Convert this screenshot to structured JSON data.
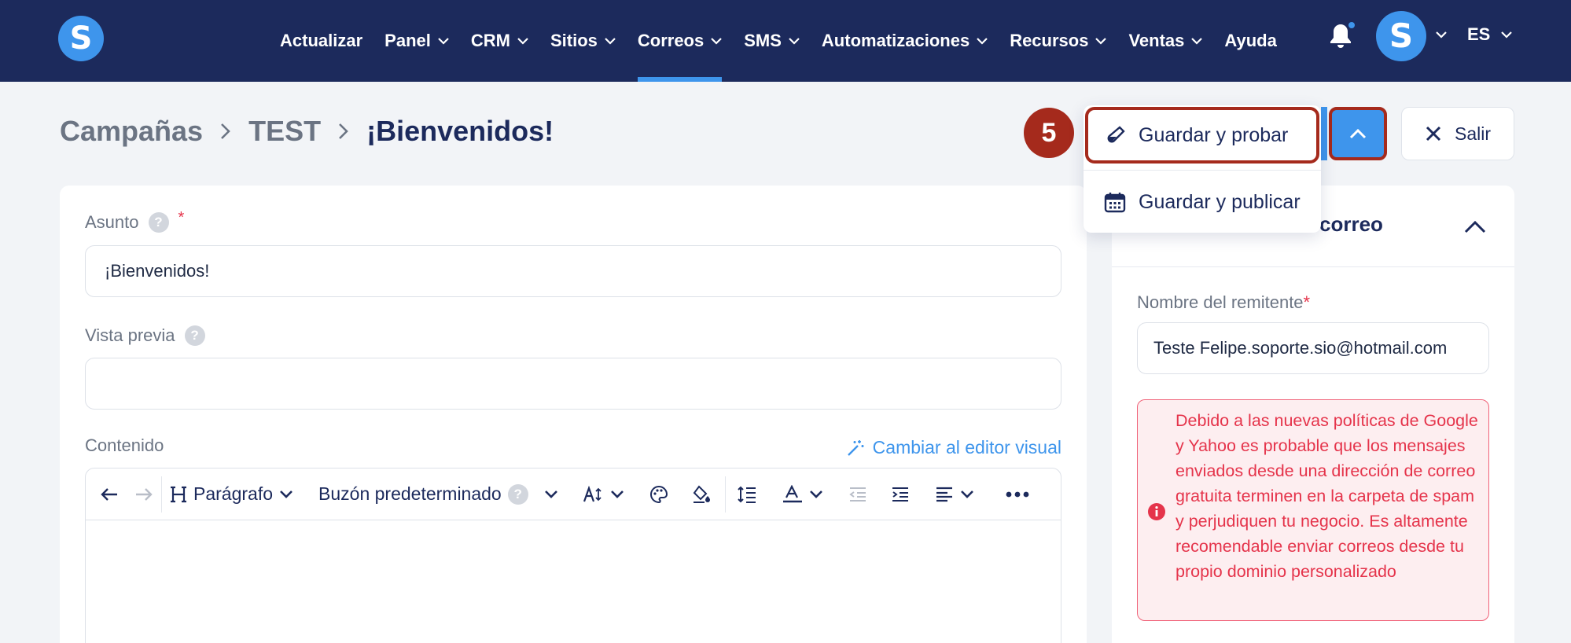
{
  "nav": {
    "logo_letter": "S",
    "items": [
      {
        "label": "Actualizar",
        "has_chevron": false,
        "active": false
      },
      {
        "label": "Panel",
        "has_chevron": true,
        "active": false
      },
      {
        "label": "CRM",
        "has_chevron": true,
        "active": false
      },
      {
        "label": "Sitios",
        "has_chevron": true,
        "active": false
      },
      {
        "label": "Correos",
        "has_chevron": true,
        "active": true
      },
      {
        "label": "SMS",
        "has_chevron": true,
        "active": false
      },
      {
        "label": "Automatizaciones",
        "has_chevron": true,
        "active": false
      },
      {
        "label": "Recursos",
        "has_chevron": true,
        "active": false
      },
      {
        "label": "Ventas",
        "has_chevron": true,
        "active": false
      },
      {
        "label": "Ayuda",
        "has_chevron": false,
        "active": false
      }
    ],
    "avatar_letter": "S",
    "language": "ES",
    "notification_icon": "bell-icon"
  },
  "breadcrumb": {
    "items": [
      "Campañas",
      "TEST"
    ],
    "current": "¡Bienvenidos!"
  },
  "actions": {
    "step_number": "5",
    "exit_label": "Salir",
    "menu": [
      {
        "label": "Guardar y probar",
        "icon": "test-tube-icon",
        "highlighted": true
      },
      {
        "label": "Guardar y publicar",
        "icon": "calendar-icon",
        "highlighted": false
      }
    ]
  },
  "form": {
    "subject_label": "Asunto",
    "subject_value": "¡Bienvenidos!",
    "preview_label": "Vista previa",
    "preview_value": "",
    "content_label": "Contenido",
    "switch_editor_label": "Cambiar al editor visual",
    "toolbar": {
      "paragraph_label": "Parágrafo",
      "mailbox_label": "Buzón predeterminado"
    }
  },
  "side_panel": {
    "title": "correo",
    "sender_label": "Nombre del remitente",
    "sender_value": "Teste Felipe.soporte.sio@hotmail.com",
    "alert_text": "Debido a las nuevas políticas de Google y Yahoo es probable que los mensajes enviados desde una dirección de correo gratuita terminen en la carpeta de spam y perjudiquen tu negocio. Es altamente recomendable enviar correos desde tu propio dominio personalizado"
  },
  "colors": {
    "nav_bg": "#1c2a5c",
    "accent": "#3e95ec",
    "highlight": "#a52a1c",
    "alert": "#e5344b"
  }
}
